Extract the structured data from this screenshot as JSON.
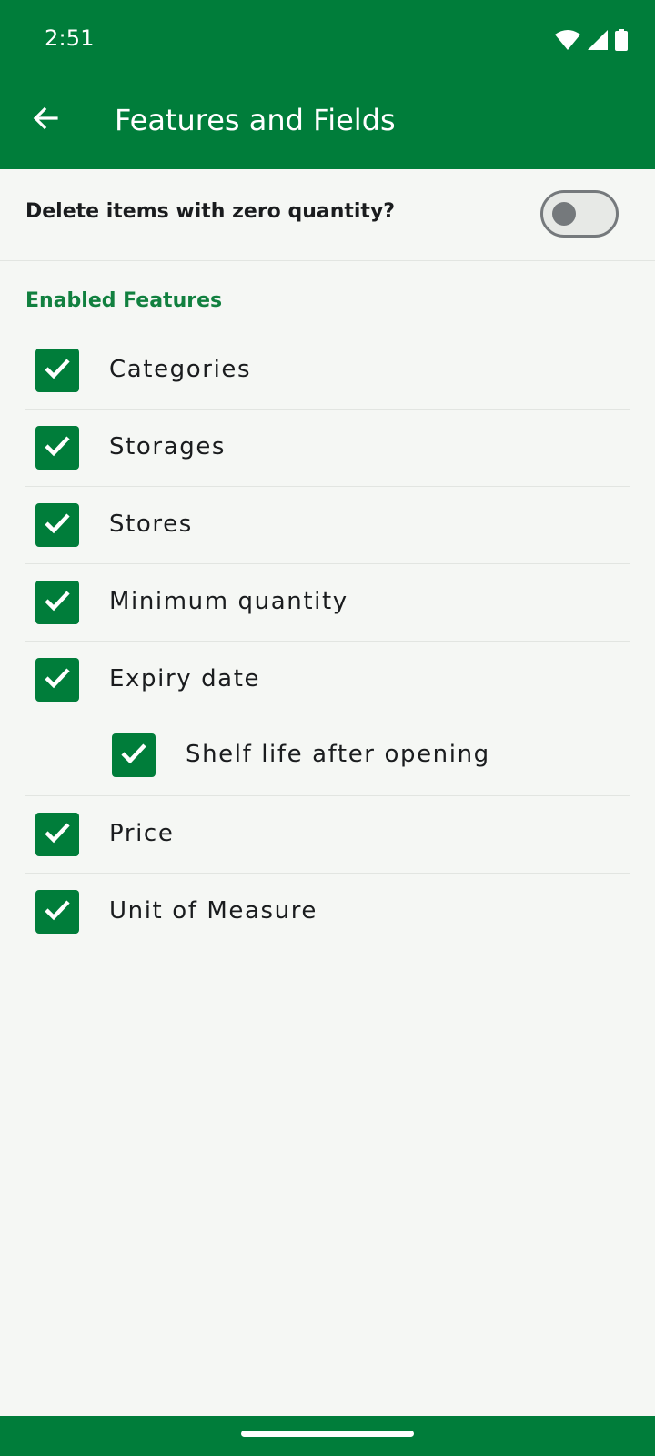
{
  "status_bar": {
    "time": "2:51",
    "icons": [
      "wifi-icon",
      "cellular-signal-icon",
      "battery-icon"
    ]
  },
  "app_bar": {
    "title": "Features and Fields",
    "back_icon": "arrow-back-icon"
  },
  "preferences": {
    "delete_zero_quantity": {
      "label": "Delete items with zero quantity?",
      "enabled": false
    }
  },
  "enabled_features": {
    "header": "Enabled Features",
    "items": [
      {
        "label": "Categories",
        "checked": true,
        "level": 0
      },
      {
        "label": "Storages",
        "checked": true,
        "level": 0
      },
      {
        "label": "Stores",
        "checked": true,
        "level": 0
      },
      {
        "label": "Minimum quantity",
        "checked": true,
        "level": 0
      },
      {
        "label": "Expiry date",
        "checked": true,
        "level": 0
      },
      {
        "label": "Shelf life after opening",
        "checked": true,
        "level": 1
      },
      {
        "label": "Price",
        "checked": true,
        "level": 0
      },
      {
        "label": "Unit of Measure",
        "checked": true,
        "level": 0
      }
    ]
  },
  "colors": {
    "primary": "#007d3a",
    "section_header": "#11803f",
    "background": "#f5f7f4",
    "switch_off": "#75797c"
  }
}
